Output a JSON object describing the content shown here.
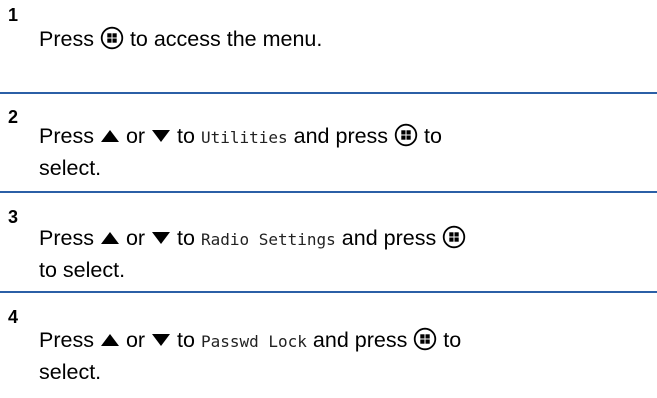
{
  "steps": [
    {
      "number": "1",
      "t1": "Press",
      "t2": "to access the menu."
    },
    {
      "number": "2",
      "t1": "Press",
      "or": "or",
      "t2": "to",
      "item": "Utilities",
      "t3": "and press",
      "t4": "to",
      "t5": "select."
    },
    {
      "number": "3",
      "t1": "Press",
      "or": "or",
      "t2": "to",
      "item": "Radio Settings",
      "t3": "and press",
      "t4": "to select."
    },
    {
      "number": "4",
      "t1": "Press",
      "or": "or",
      "t2": "to",
      "item": "Passwd Lock",
      "t3": "and press",
      "t4": "to",
      "t5": "select."
    }
  ],
  "icons": {
    "menu_button": "menu-ok-button-icon",
    "up": "up-arrow-icon",
    "down": "down-arrow-icon"
  },
  "colors": {
    "divider": "#2b5fa6"
  }
}
